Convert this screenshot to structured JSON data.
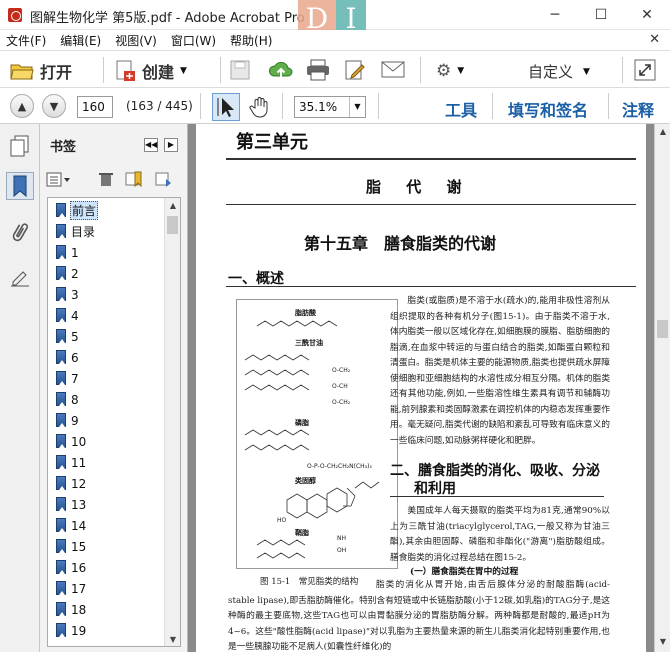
{
  "window": {
    "title": "图解生物化学 第5版.pdf - Adobe Acrobat Pro",
    "logo_left": "D",
    "logo_right": "I",
    "minimize": "─",
    "maximize": "☐",
    "close": "✕"
  },
  "menu": {
    "items": [
      "文件(F)",
      "编辑(E)",
      "视图(V)",
      "窗口(W)",
      "帮助(H)"
    ],
    "close_doc": "✕"
  },
  "toolbar": {
    "open_label": "打开",
    "create_label": "创建",
    "customize_label": "自定义"
  },
  "nav": {
    "page_value": "160",
    "page_count": "(163 / 445)",
    "zoom_value": "35.1%",
    "tools_label": "工具",
    "fill_sign_label": "填写和签名",
    "comment_label": "注释"
  },
  "bookmarks": {
    "title": "书签",
    "items": [
      "前言",
      "目录",
      "1",
      "2",
      "3",
      "4",
      "5",
      "6",
      "7",
      "8",
      "9",
      "10",
      "11",
      "12",
      "13",
      "14",
      "15",
      "16",
      "17",
      "18",
      "19"
    ],
    "selected_index": 0
  },
  "document": {
    "unit_title": "第三单元",
    "part_title": "脂 代 谢",
    "chapter_title": "第十五章　膳食脂类的代谢",
    "section1": "一、概述",
    "section2_line1": "二、膳食脂类的消化、吸收、分泌",
    "section2_line2": "和利用",
    "sub1": "(一）膳食脂类在胃中的过程",
    "figure_caption": "图 15-1　常见脂类的结构",
    "figure_labels": [
      "脂肪酸",
      "三酰甘油",
      "磷脂",
      "类固醇",
      "鞘脂"
    ],
    "para1": "脂类(或脂质)是不溶于水(疏水)的,能用非极性溶剂从组织提取的各种有机分子(图15-1)。由于脂类不溶于水,体内脂类一般以区域化存在,如细胞膜的膜脂、脂肪细胞的脂滴,在血浆中转运的与蛋白结合的脂类,如酯蛋白颗粒和清蛋白。脂类是机体主要的能源物质,脂类也提供疏水屏障使细胞和亚细胞结构的水溶性成分相互分隔。机体的脂类还有其他功能,例如,一些脂溶性维生素具有调节和辅酶功能,前列腺素和类固醇激素在调控机体的内稳态发挥重要作用。毫无疑问,脂类代谢的缺陷和紊乱可导致有临床意义的一些临床问题,如动脉粥样硬化和肥胖。",
    "para2": "美国成年人每天摄取的脂类平均为81克,通常90%以上为三酰甘油(triacylglycerol,TAG,一般又称为甘油三酯),其余由胆固醇、磷脂和非酯化(\"游离\")脂肪酸组成。膳食脂类的消化过程总结在图15-2。",
    "para3": "脂类的消化从胃开始,由舌后腺体分泌的耐酸脂酶(acid-stable lipase),即舌脂肪酶催化。特别含有短链或中长链脂肪酸(小于12碳,如乳脂)的TAG分子,是这种酶的最主要底物,这些TAG也可以由胃黏膜分泌的胃脂肪酶分解。两种酶都是耐酸的,最适pH为4~6。这些\"酸性脂酶(acid lipase)\"对以乳脂为主要热量来源的新生儿脂类消化起特别重要作用,也是一些胰腺功能不足病人(如囊性纤维化)的"
  }
}
